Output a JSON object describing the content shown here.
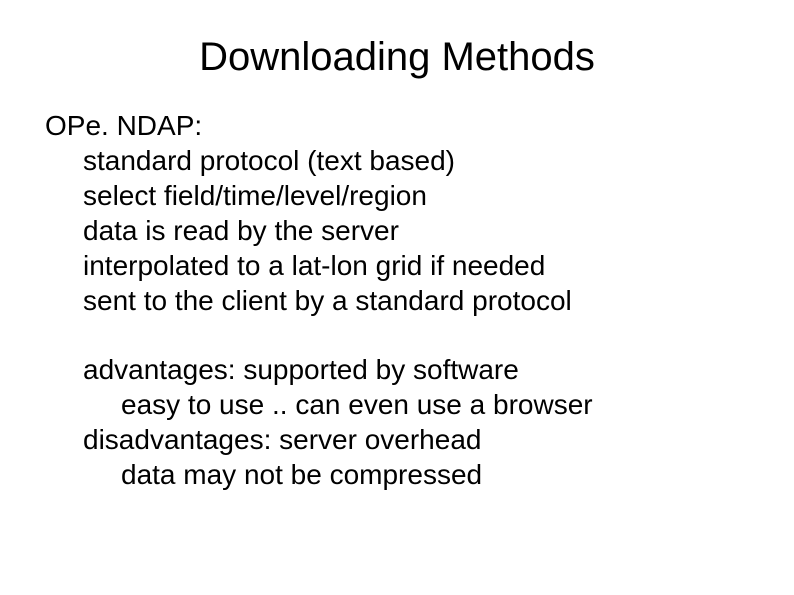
{
  "title": "Downloading Methods",
  "section_header": "OPe. NDAP:",
  "items": [
    "standard protocol (text based)",
    "select field/time/level/region",
    "data is read by the server",
    "interpolated to a lat-lon grid if needed",
    "sent to the client by a standard protocol"
  ],
  "advantages_label": "advantages: supported by software",
  "advantages_sub": "easy to use .. can even use a browser",
  "disadvantages_label": "disadvantages: server overhead",
  "disadvantages_sub": "data may not be compressed"
}
